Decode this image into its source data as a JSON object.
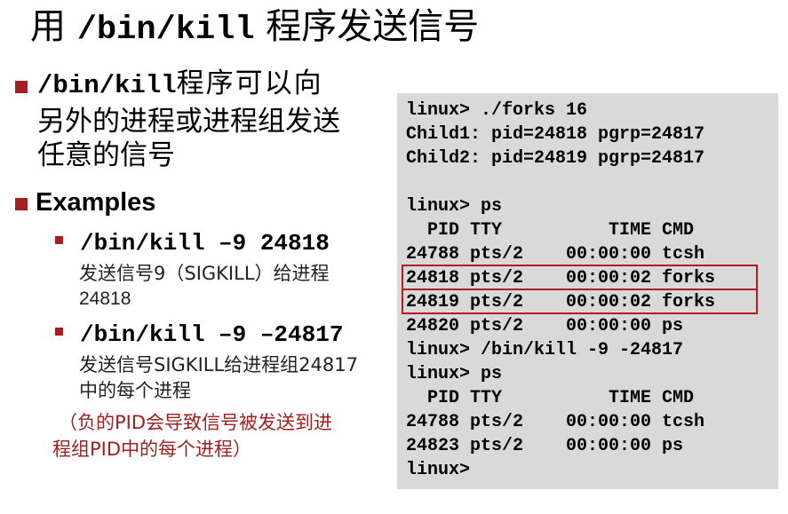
{
  "colors": {
    "bullet_red": "#a41e22",
    "note_text": "#a02020",
    "terminal_bg": "#d9d9d9",
    "highlight_border": "#b01c22"
  },
  "title": {
    "prefix": "用 ",
    "command": "/bin/kill",
    "suffix": " 程序发送信号"
  },
  "bullet1": {
    "command": "/bin/kill",
    "line1_rest": "程序可以向",
    "line2": "另外的进程或进程组发送",
    "line3": "任意的信号"
  },
  "bullet2": {
    "label": "Examples"
  },
  "examples": [
    {
      "command": "/bin/kill –9 24818",
      "desc_line1": "发送信号9（SIGKILL）给进程",
      "desc_line2": "24818"
    },
    {
      "command": "/bin/kill –9 –24817",
      "desc_line1": "发送信号SIGKILL给进程组24817",
      "desc_line2": "中的每个进程"
    }
  ],
  "note": {
    "line1": "（负的PID会导致信号被发送到进",
    "line2": "程组PID中的每个进程）"
  },
  "terminal": {
    "lines": [
      "linux> ./forks 16",
      "Child1: pid=24818 pgrp=24817",
      "Child2: pid=24819 pgrp=24817",
      "",
      "linux> ps",
      "  PID TTY          TIME CMD",
      "24788 pts/2    00:00:00 tcsh",
      "24818 pts/2    00:00:02 forks",
      "24819 pts/2    00:00:02 forks",
      "24820 pts/2    00:00:00 ps",
      "linux> /bin/kill -9 -24817",
      "linux> ps",
      "  PID TTY          TIME CMD",
      "24788 pts/2    00:00:00 tcsh",
      "24823 pts/2    00:00:00 ps",
      "linux>"
    ],
    "highlighted_line_indices": [
      7,
      8
    ]
  }
}
